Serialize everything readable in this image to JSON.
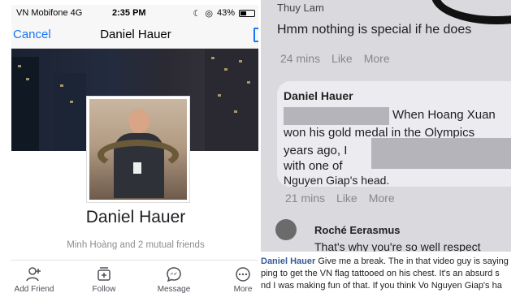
{
  "left": {
    "status": {
      "carrier": "VN Mobifone  4G",
      "time": "2:35 PM",
      "battery": "43%",
      "battery_level": 0.43
    },
    "nav": {
      "cancel_label": "Cancel",
      "title": "Daniel Hauer"
    },
    "profile": {
      "name": "Daniel Hauer",
      "mutual": "Minh Hoàng and 2 mutual friends"
    },
    "actions": [
      {
        "label": "Add Friend",
        "icon": "add-friend-icon"
      },
      {
        "label": "Follow",
        "icon": "follow-icon"
      },
      {
        "label": "Message",
        "icon": "messenger-icon"
      },
      {
        "label": "More",
        "icon": "more-icon"
      }
    ]
  },
  "right": {
    "top_comment": {
      "author": "Thuy Lam",
      "text": "Hmm nothing is special if he does",
      "time": "24 mins",
      "like": "Like",
      "more": "More"
    },
    "main_comment": {
      "author": "Daniel Hauer",
      "line1": "When Hoang Xuan",
      "line2": "won his gold medal in the Olympics",
      "line3": "years ago, I",
      "line4": "with one of",
      "line5": "Nguyen Giap's head.",
      "time": "21 mins",
      "like": "Like",
      "more": "More"
    },
    "reply": {
      "author": "Roché Eerasmus",
      "text": "That's why you're so well respect"
    }
  },
  "bottom": {
    "author": "Daniel Hauer",
    "line1": "Give me a break. The in that video guy is saying",
    "line2": "ping to get the VN flag tattooed on his chest. It's an absurd s",
    "line3": "nd I was making fun of that. If you think Vo Nguyen Giap's ha"
  }
}
